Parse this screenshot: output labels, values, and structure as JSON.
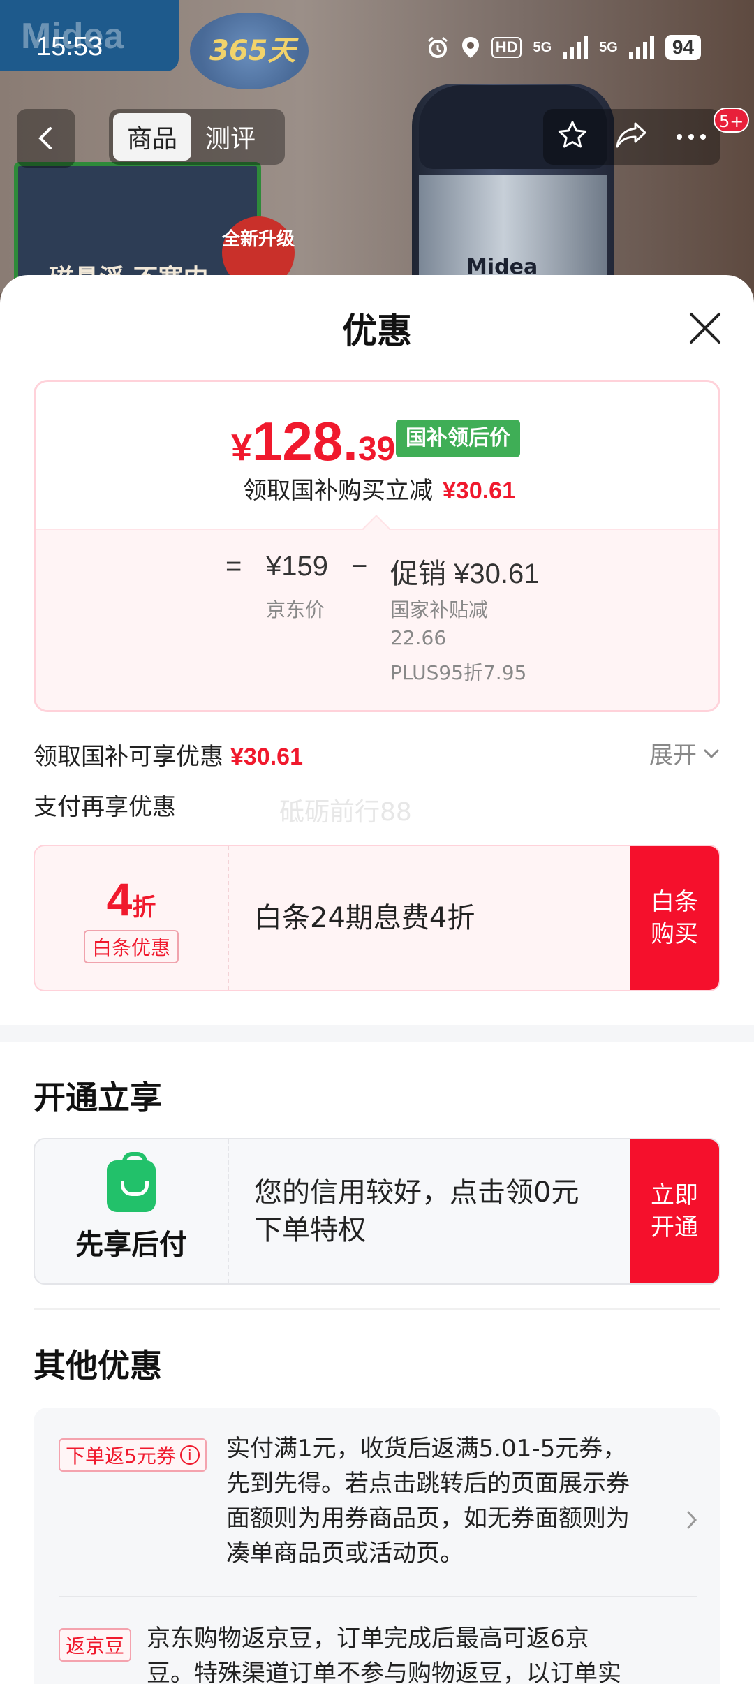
{
  "status_bar": {
    "time": "15:53",
    "network_hd": "HD",
    "net1": "5G",
    "net2": "5G",
    "battery": "94"
  },
  "background": {
    "brand_logo": "Midea",
    "badge_text": "365天",
    "panel_text": "磁悬浮 不寒内",
    "upgrade_text": "全新升级",
    "product_logo": "Midea"
  },
  "nav": {
    "tabs": [
      {
        "label": "商品",
        "active": true
      },
      {
        "label": "测评",
        "active": false
      }
    ],
    "cart_count": "5+"
  },
  "sheet": {
    "title": "优惠",
    "price": {
      "symbol": "¥",
      "integer": "128.",
      "decimal": "39",
      "tag": "国补领后价",
      "subtitle": "领取国补购买立减",
      "subtitle_amount": "¥30.61"
    },
    "formula": {
      "equals": "=",
      "jd_price": "¥159",
      "minus": "−",
      "promo": "促销 ¥30.61",
      "jd_price_label": "京东价",
      "promo_detail_1": "国家补贴减",
      "promo_detail_2": "22.66",
      "promo_detail_3": "PLUS95折7.95"
    },
    "subsidy_row": {
      "label": "领取国补可享优惠",
      "amount": "¥30.61",
      "expand": "展开"
    },
    "pay_row_label": "支付再享优惠",
    "watermark": "砥砺前行88",
    "baitiao": {
      "discount_num": "4",
      "discount_unit": "折",
      "tag": "白条优惠",
      "desc": "白条24期息费4折",
      "btn_line1": "白条",
      "btn_line2": "购买"
    },
    "open_section": {
      "title": "开通立享",
      "pay_label": "先享后付",
      "desc_line1": "您的信用较好，点击领0元",
      "desc_line2": "下单特权",
      "btn_line1": "立即",
      "btn_line2": "开通"
    },
    "other_section": {
      "title": "其他优惠",
      "items": [
        {
          "tag": "下单返5元券",
          "lines": [
            "实付满1元，收货后返满5.01-5元券，",
            "先到先得。若点击跳转后的页面展示券",
            "面额则为用券商品页，如无券面额则为",
            "凑单商品页或活动页。"
          ]
        },
        {
          "tag": "返京豆",
          "lines": [
            "京东购物返京豆，订单完成后最高可返6京",
            "豆。特殊渠道订单不参与购物返豆，以订单实"
          ]
        }
      ]
    }
  },
  "colors": {
    "accent_red": "#f0192d",
    "tag_green": "#3fae56",
    "pay_green": "#22c16a"
  }
}
